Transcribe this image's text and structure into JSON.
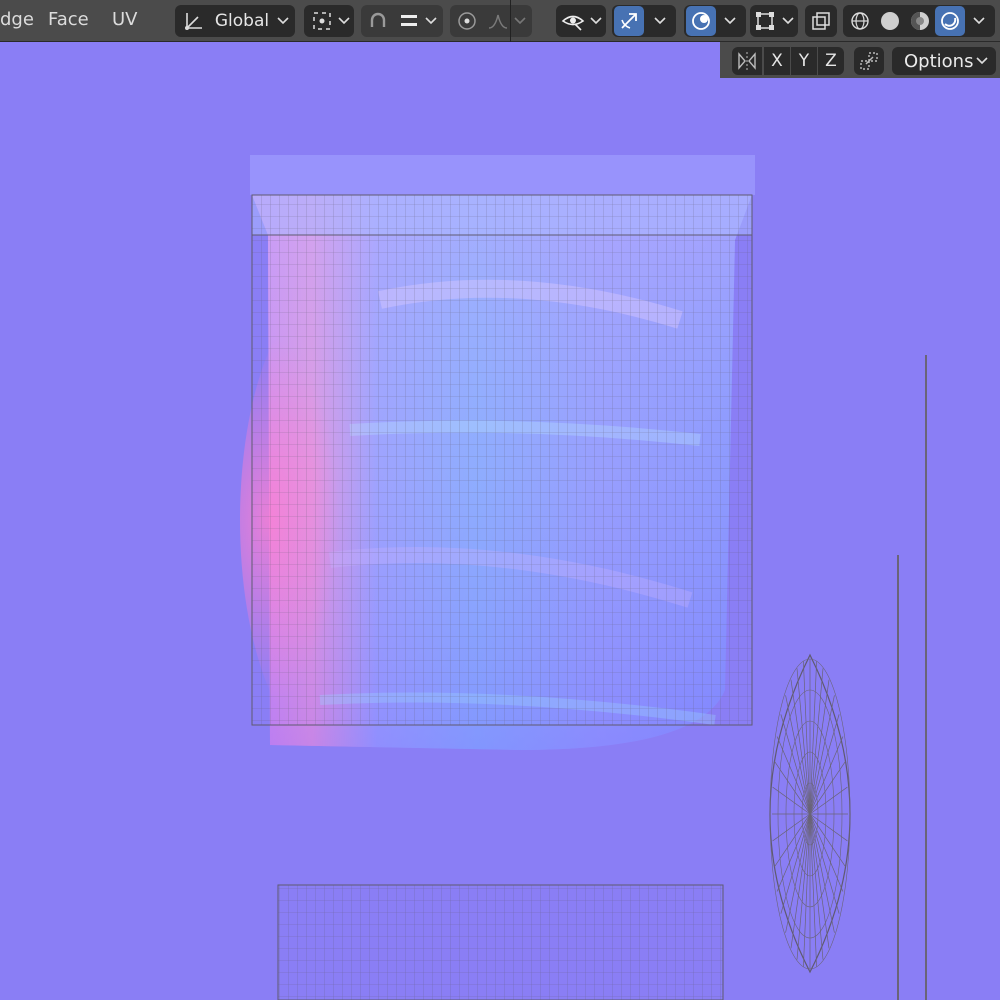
{
  "header": {
    "menu": {
      "edge_label": "dge",
      "face_label": "Face",
      "uv_label": "UV"
    },
    "transform_orientation": {
      "label": "Global",
      "icon": "transform-orientation-icon"
    },
    "pivot_icon": "pivot-point-icon",
    "snap_icon": "snap-magnet-icon",
    "snap_target_icon": "snap-increment-icon",
    "proportional_icon": "proportional-editing-icon",
    "falloff_icon": "falloff-curve-icon",
    "visibility_icon": "eye-visibility-icon",
    "gizmo_icon": "gizmo-icon",
    "overlays_icon": "overlays-icon",
    "mesh_edit_overlay_icon": "mesh-edit-icon",
    "xray_icon": "xray-icon",
    "shading": {
      "wireframe_icon": "wireframe-shading-icon",
      "solid_icon": "solid-shading-icon",
      "material_icon": "material-preview-icon",
      "rendered_icon": "rendered-shading-icon"
    }
  },
  "toolbar_row2": {
    "mirror_icon": "mirror-icon",
    "x_label": "X",
    "y_label": "Y",
    "z_label": "Z",
    "auto_merge_icon": "auto-merge-icon",
    "options_label": "Options"
  },
  "colors": {
    "viewport_bg": "#8a7ef5",
    "header_bg": "#4b4b4b",
    "button_bg": "#2a2a2a",
    "accent": "#4772b3",
    "wire": "#6a6478"
  }
}
